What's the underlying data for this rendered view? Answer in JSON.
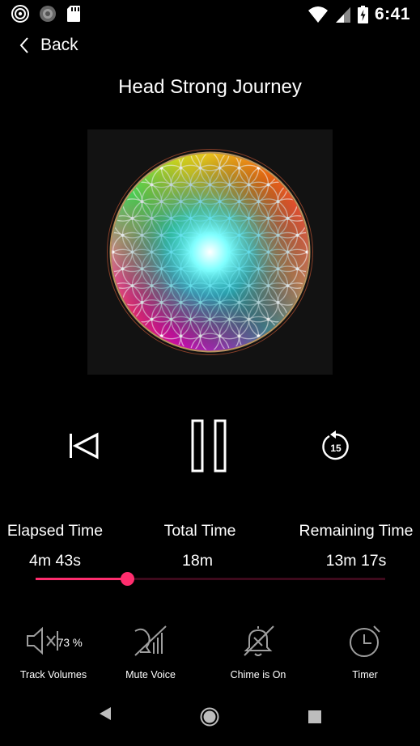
{
  "status_bar": {
    "time": "6:41",
    "left_icons": [
      "spiral-app-icon",
      "globe-app-icon",
      "sd-card-icon"
    ],
    "right_icons": [
      "wifi-icon",
      "cell-signal-icon",
      "battery-charging-icon"
    ]
  },
  "header": {
    "back_label": "Back",
    "title": "Head Strong Journey"
  },
  "player": {
    "previous_icon": "skip-previous-icon",
    "pause_icon": "pause-icon",
    "replay_label": "15",
    "replay_icon": "replay-15-icon"
  },
  "times": {
    "elapsed_label": "Elapsed Time",
    "elapsed_value": "4m 43s",
    "total_label": "Total Time",
    "total_value": "18m",
    "remaining_label": "Remaining Time",
    "remaining_value": "13m 17s"
  },
  "progress": {
    "fraction": 0.262
  },
  "tools": {
    "track_volumes_label": "Track Volumes",
    "volume_percent": "73 %",
    "mute_voice_label": "Mute Voice",
    "chime_label": "Chime is On",
    "timer_label": "Timer"
  },
  "colors": {
    "accent": "#ff2d6e",
    "track_bg": "#3d0a1c",
    "icon_gray": "#9e9e9e",
    "background": "#000000"
  }
}
